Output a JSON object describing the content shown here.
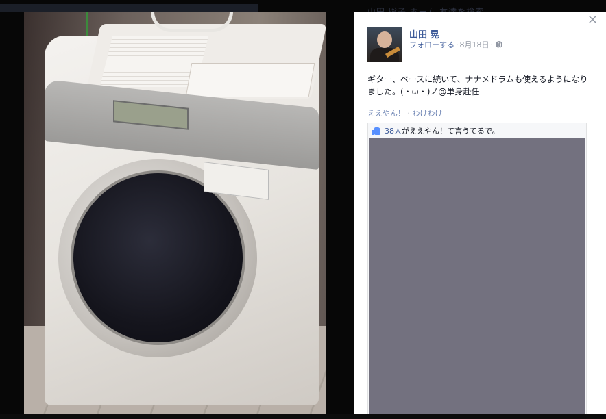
{
  "header_ghost": {
    "text": "山田 聡子    ホーム    友達を検索"
  },
  "post": {
    "author": "山田 晃",
    "follow_label": "フォローする",
    "separator": "·",
    "date": "8月18日",
    "text": "ギター、ベースに続いて、ナナメドラムも使えるようになりました。(・ω・)ノ@単身赴任",
    "actions": {
      "like": "ええやん！",
      "dot": " · ",
      "share": "わけわけ"
    },
    "likes": {
      "count": "38人",
      "suffix": "がええやん！て言うてるで。"
    }
  },
  "close_label": "×",
  "icons": [
    "close-icon",
    "globe-icon",
    "thumb-up-icon"
  ],
  "colors": {
    "link": "#3b5998",
    "muted": "#9197a3",
    "like_blue": "#5890ff",
    "comments_bg": "#73717f"
  }
}
